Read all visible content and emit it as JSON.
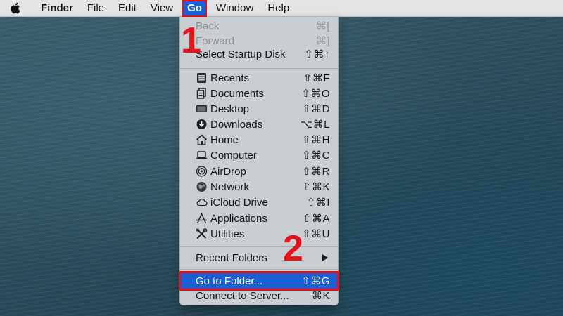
{
  "menubar": {
    "app_name": "Finder",
    "items": [
      {
        "label": "File"
      },
      {
        "label": "Edit"
      },
      {
        "label": "View"
      },
      {
        "label": "Go"
      },
      {
        "label": "Window"
      },
      {
        "label": "Help"
      }
    ]
  },
  "go_menu": {
    "group1": [
      {
        "label": "Back",
        "shortcut": "⌘[",
        "enabled": false
      },
      {
        "label": "Forward",
        "shortcut": "⌘]",
        "enabled": false
      },
      {
        "label": "Select Startup Disk",
        "shortcut": "⇧⌘↑",
        "enabled": true
      }
    ],
    "group2": [
      {
        "label": "Recents",
        "shortcut": "⇧⌘F",
        "icon": "recents-icon"
      },
      {
        "label": "Documents",
        "shortcut": "⇧⌘O",
        "icon": "documents-icon"
      },
      {
        "label": "Desktop",
        "shortcut": "⇧⌘D",
        "icon": "desktop-icon"
      },
      {
        "label": "Downloads",
        "shortcut": "⌥⌘L",
        "icon": "downloads-icon"
      },
      {
        "label": "Home",
        "shortcut": "⇧⌘H",
        "icon": "home-icon"
      },
      {
        "label": "Computer",
        "shortcut": "⇧⌘C",
        "icon": "computer-icon"
      },
      {
        "label": "AirDrop",
        "shortcut": "⇧⌘R",
        "icon": "airdrop-icon"
      },
      {
        "label": "Network",
        "shortcut": "⇧⌘K",
        "icon": "network-icon"
      },
      {
        "label": "iCloud Drive",
        "shortcut": "⇧⌘I",
        "icon": "icloud-icon"
      },
      {
        "label": "Applications",
        "shortcut": "⇧⌘A",
        "icon": "applications-icon"
      },
      {
        "label": "Utilities",
        "shortcut": "⇧⌘U",
        "icon": "utilities-icon"
      }
    ],
    "recent_folders": {
      "label": "Recent Folders"
    },
    "group3": [
      {
        "label": "Go to Folder...",
        "shortcut": "⇧⌘G",
        "highlighted": true
      },
      {
        "label": "Connect to Server...",
        "shortcut": "⌘K",
        "highlighted": false
      }
    ]
  },
  "annotations": {
    "step1": "1",
    "step2": "2"
  },
  "colors": {
    "highlight": "#1a5fd6",
    "annotation_red": "#e3131b"
  }
}
